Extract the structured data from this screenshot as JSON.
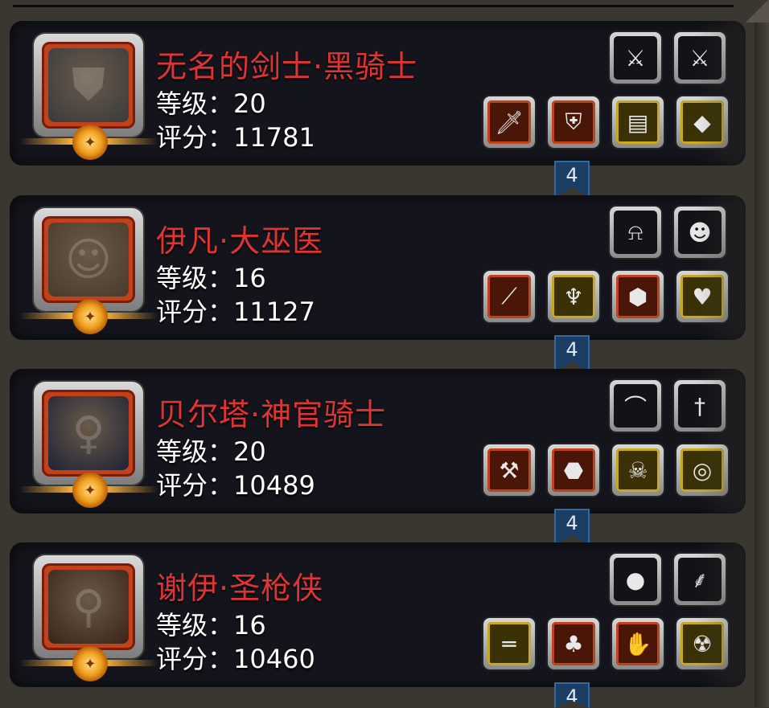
{
  "level_prefix": "等级：",
  "score_prefix": "评分：",
  "heroes": [
    {
      "name": "无名的剑士·黑骑士",
      "level_text": "等级：20",
      "score_text": "评分：11781",
      "portrait_color": "#3a3a3c",
      "portrait_icon": "helmet-knight",
      "marker": "4",
      "top_items": [
        {
          "icon": "greatsword-icon",
          "frame": "dark"
        },
        {
          "icon": "greatsword-icon",
          "frame": "dark"
        }
      ],
      "bottom_items": [
        {
          "icon": "sword-icon",
          "frame": "red"
        },
        {
          "icon": "armor-icon",
          "frame": "red"
        },
        {
          "icon": "scroll-icon",
          "frame": "gold"
        },
        {
          "icon": "gem-icon",
          "frame": "gold"
        }
      ]
    },
    {
      "name": "伊凡·大巫医",
      "level_text": "等级：16",
      "score_text": "评分：11127",
      "portrait_color": "#4a3a2a",
      "portrait_icon": "old-shaman",
      "marker": "4",
      "top_items": [
        {
          "icon": "bell-icon",
          "frame": "dark"
        },
        {
          "icon": "mask-icon",
          "frame": "dark"
        }
      ],
      "bottom_items": [
        {
          "icon": "staff-icon",
          "frame": "red"
        },
        {
          "icon": "horned-helm-icon",
          "frame": "gold"
        },
        {
          "icon": "orb-icon",
          "frame": "red"
        },
        {
          "icon": "amulet-icon",
          "frame": "gold"
        }
      ]
    },
    {
      "name": "贝尔塔·神官骑士",
      "level_text": "等级：20",
      "score_text": "评分：10489",
      "portrait_color": "#1f2236",
      "portrait_icon": "hooded-priestess",
      "marker": "4",
      "top_items": [
        {
          "icon": "whip-icon",
          "frame": "dark"
        },
        {
          "icon": "scepter-icon",
          "frame": "dark"
        }
      ],
      "bottom_items": [
        {
          "icon": "hammer-icon",
          "frame": "red"
        },
        {
          "icon": "pauldron-icon",
          "frame": "red"
        },
        {
          "icon": "skull-mask-icon",
          "frame": "gold"
        },
        {
          "icon": "ring-icon",
          "frame": "gold"
        }
      ]
    },
    {
      "name": "谢伊·圣枪侠",
      "level_text": "等级：16",
      "score_text": "评分：10460",
      "portrait_color": "#3a2418",
      "portrait_icon": "gunslinger-hat",
      "marker": "4",
      "top_items": [
        {
          "icon": "pearl-orb-icon",
          "frame": "dark"
        },
        {
          "icon": "feather-icon",
          "frame": "dark"
        }
      ],
      "bottom_items": [
        {
          "icon": "rifle-icon",
          "frame": "gold"
        },
        {
          "icon": "vest-icon",
          "frame": "red"
        },
        {
          "icon": "gauntlet-icon",
          "frame": "red"
        },
        {
          "icon": "skull-charm-icon",
          "frame": "gold"
        }
      ]
    }
  ]
}
